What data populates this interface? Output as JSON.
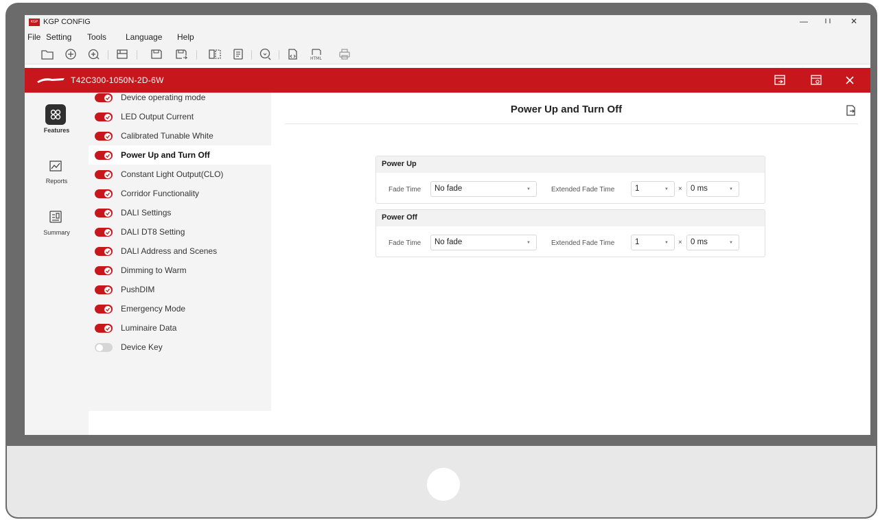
{
  "window": {
    "title": "KGP CONFIG",
    "logo_text": "KGP",
    "minimize": "—",
    "maximize": "⬚",
    "close": "✕"
  },
  "menu": [
    "File",
    "Setting",
    "Tools",
    "Language",
    "Help"
  ],
  "toolbar": {
    "icons": [
      "open-folder-icon",
      "add-circle-icon",
      "add-device-icon",
      "read-icon",
      "save-icon",
      "save-as-icon",
      "compare-icon",
      "document-icon",
      "read-device-icon",
      "export-code-icon",
      "html-export-icon",
      "print-icon"
    ]
  },
  "device": {
    "name": "T42C300-1050N-2D-6W"
  },
  "nav": [
    {
      "label": "Features",
      "icon": "features-icon",
      "active": true
    },
    {
      "label": "Reports",
      "icon": "reports-chart-icon",
      "active": false
    },
    {
      "label": "Summary",
      "icon": "summary-icon",
      "active": false
    }
  ],
  "features": [
    {
      "label": "Device operating mode",
      "enabled": true
    },
    {
      "label": "LED Output Current",
      "enabled": true
    },
    {
      "label": "Calibrated Tunable White",
      "enabled": true
    },
    {
      "label": "Power Up and Turn Off",
      "enabled": true,
      "active": true
    },
    {
      "label": "Constant Light Output(CLO)",
      "enabled": true
    },
    {
      "label": "Corridor Functionality",
      "enabled": true
    },
    {
      "label": "DALI Settings",
      "enabled": true
    },
    {
      "label": "DALI DT8 Setting",
      "enabled": true
    },
    {
      "label": "DALI Address and Scenes",
      "enabled": true
    },
    {
      "label": "Dimming to Warm",
      "enabled": true
    },
    {
      "label": "PushDIM",
      "enabled": true
    },
    {
      "label": "Emergency Mode",
      "enabled": true
    },
    {
      "label": "Luminaire Data",
      "enabled": true
    },
    {
      "label": "Device Key",
      "enabled": false
    }
  ],
  "content": {
    "title": "Power Up and Turn Off",
    "panels": [
      {
        "title": "Power Up",
        "fade_time_label": "Fade Time",
        "fade_time_value": "No fade",
        "extended_label": "Extended Fade Time",
        "extended_multiplier": "1",
        "times_symbol": "×",
        "extended_base": "0 ms"
      },
      {
        "title": "Power Off",
        "fade_time_label": "Fade Time",
        "fade_time_value": "No fade",
        "extended_label": "Extended Fade Time",
        "extended_multiplier": "1",
        "times_symbol": "×",
        "extended_base": "0 ms"
      }
    ]
  },
  "colors": {
    "brand_red": "#c8161d",
    "sidebar_bg": "#f4f4f4",
    "bezel": "#6b6b6b"
  }
}
